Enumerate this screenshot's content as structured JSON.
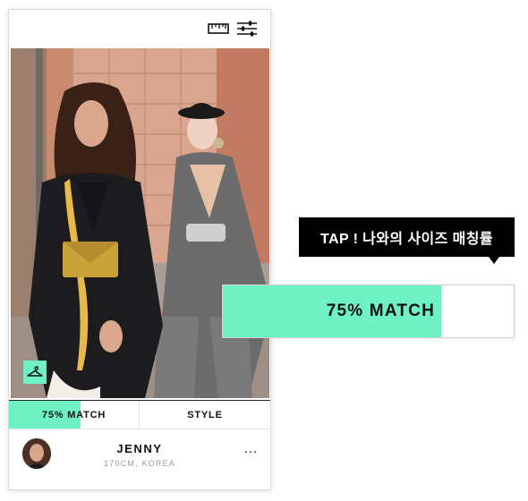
{
  "app": {
    "name": "fashion-size-match"
  },
  "topbar": {
    "icons": [
      "ruler-icon",
      "filter-sliders-icon"
    ]
  },
  "tabs": {
    "match_label": "75% MATCH",
    "style_label": "STYLE",
    "match_percent": 75
  },
  "profile": {
    "name": "JENNY",
    "meta": "170CM, KOREA",
    "more": "…"
  },
  "callout": {
    "tooltip": "TAP ! 나와의 사이즈 매칭률",
    "match_label": "75% MATCH",
    "match_percent": 75
  },
  "colors": {
    "accent": "#6ff2c3",
    "tooltip_bg": "#000000",
    "text": "#111111",
    "muted": "#9a9a9a"
  }
}
